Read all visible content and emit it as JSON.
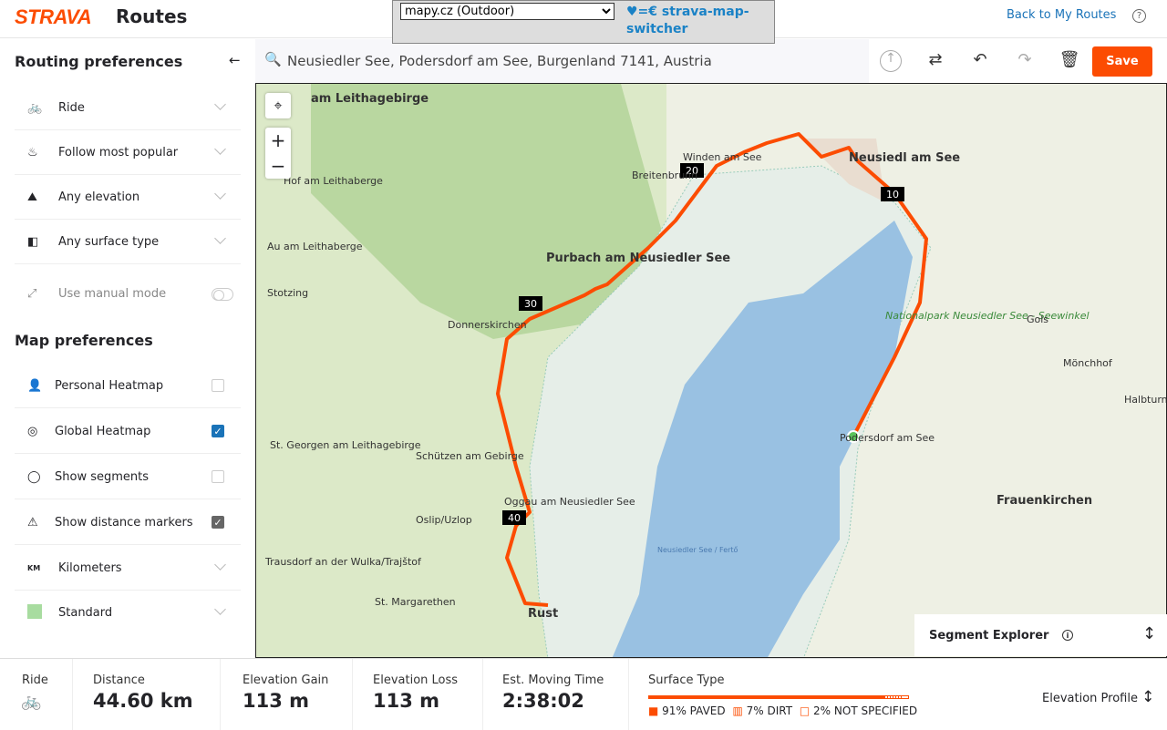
{
  "header": {
    "logo": "STRAVA",
    "title": "Routes",
    "back_link": "Back to My Routes",
    "help_icon": "?"
  },
  "extension": {
    "selected_map": "mapy.cz (Outdoor)",
    "link": "♥=€ strava-map-switcher"
  },
  "sidebar": {
    "routing_title": "Routing preferences",
    "collapse_icon": "←",
    "routing_items": [
      {
        "label": "Ride",
        "icon": "bike-icon"
      },
      {
        "label": "Follow most popular",
        "icon": "popular-icon"
      },
      {
        "label": "Any elevation",
        "icon": "elevation-icon"
      },
      {
        "label": "Any surface type",
        "icon": "surface-icon"
      }
    ],
    "manual_mode": "Use manual mode",
    "map_title": "Map preferences",
    "map_items": [
      {
        "label": "Personal Heatmap",
        "checked": false
      },
      {
        "label": "Global Heatmap",
        "checked": true
      },
      {
        "label": "Show segments",
        "checked": false
      },
      {
        "label": "Show distance markers",
        "checked": true
      }
    ],
    "units": "Kilometers",
    "units_icon": "KM",
    "style": "Standard"
  },
  "search": {
    "value": "Neusiedler See, Podersdorf am See, Burgenland 7141, Austria"
  },
  "toolbar": {
    "save": "Save"
  },
  "map": {
    "labels": [
      "am Leithagebirge",
      "Hof am Leithaberge",
      "Purbach am Neusiedler See",
      "Neusiedl am See",
      "Donnerskirchen",
      "Breitenbrunn",
      "Winden am See",
      "Nationalpark Neusiedler See - Seewinkel",
      "Podersdorf am See",
      "Frauenkirchen",
      "Schützen am Gebirge",
      "St. Georgen am Leithagebirge",
      "Oggau am Neusiedler See",
      "Oslip/Uzlop",
      "Trausdorf an der Wulka/Trajštof",
      "St. Margarethen",
      "Rust",
      "Neusiedler See / Fertő",
      "Mönchhof",
      "Gols",
      "Halbturn",
      "Stotzing",
      "Au am Leithaberge"
    ],
    "distance_markers": [
      "10",
      "20",
      "30",
      "40"
    ],
    "route_color": "#fc4c02"
  },
  "segment_explorer": "Segment Explorer",
  "stats": {
    "sport": "Ride",
    "distance_label": "Distance",
    "distance": "44.60 km",
    "gain_label": "Elevation Gain",
    "gain": "113 m",
    "loss_label": "Elevation Loss",
    "loss": "113 m",
    "time_label": "Est. Moving Time",
    "time": "2:38:02",
    "surface_label": "Surface Type",
    "surface": {
      "paved": 91,
      "dirt": 7,
      "unspecified": 2
    },
    "paved": "91% PAVED",
    "dirt": "7% DIRT",
    "unspec": "2% NOT SPECIFIED",
    "elevation_profile": "Elevation Profile"
  }
}
